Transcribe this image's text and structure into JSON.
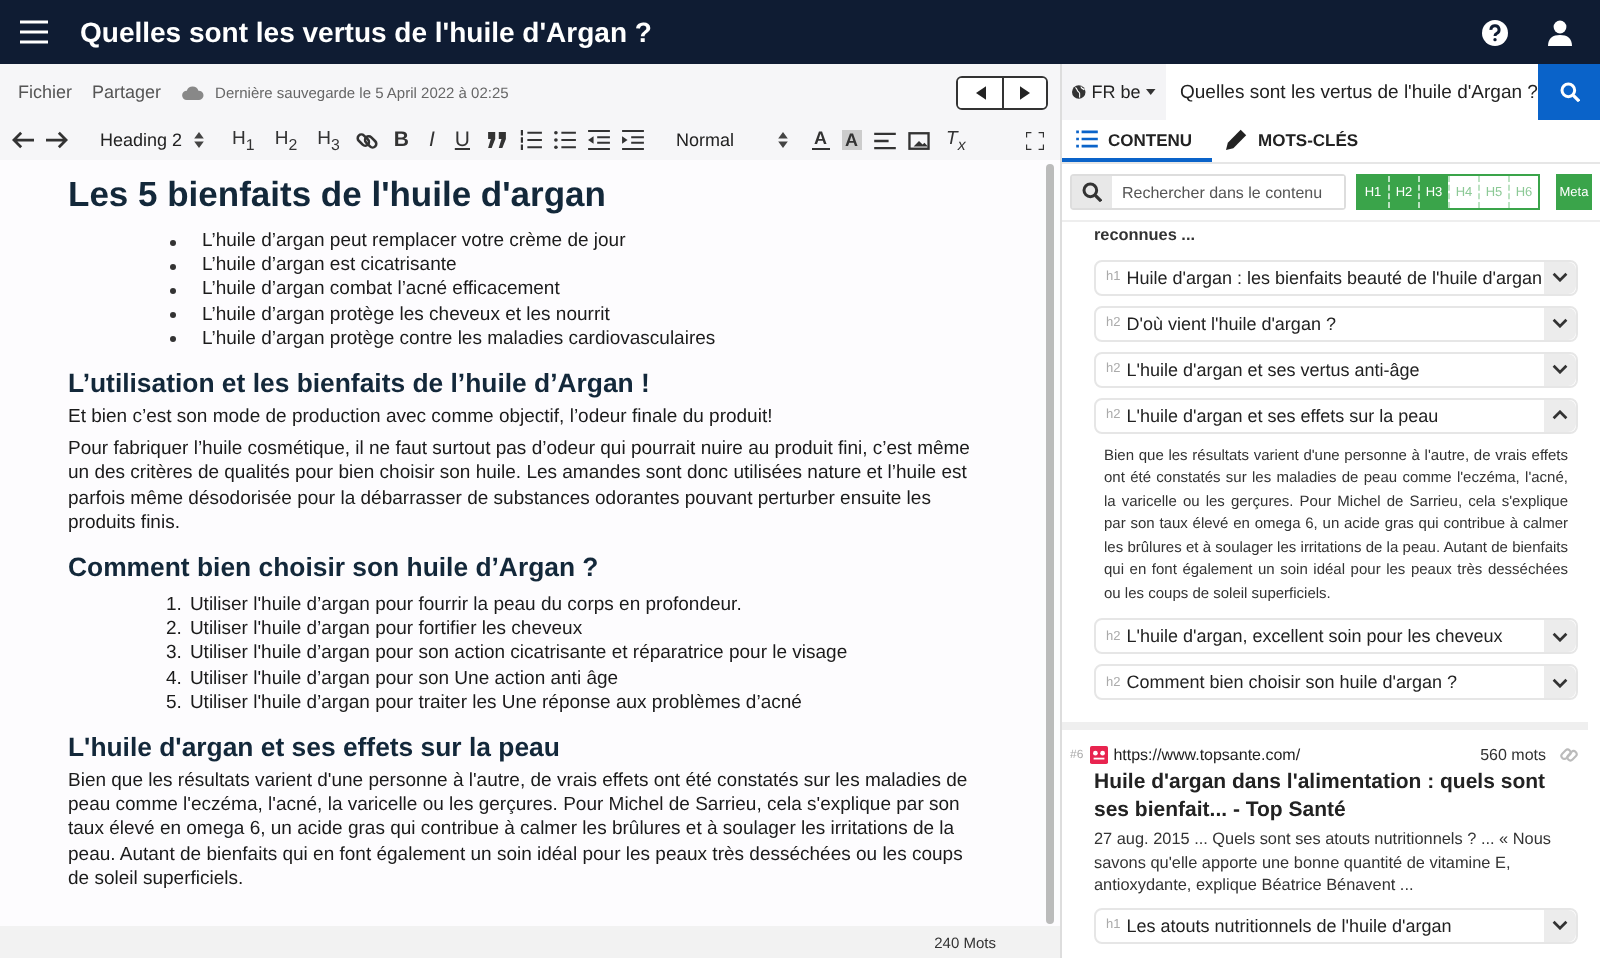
{
  "top_bar": {
    "title": "Quelles sont les vertus de l'huile d'Argan ?"
  },
  "menu": {
    "items": [
      "Fichier",
      "Partager"
    ],
    "save_status": "Dernière sauvegarde le 5 April 2022 à 02:25"
  },
  "toolbar": {
    "heading_select": "Heading 2",
    "heading_buttons": [
      "H$_{1}$",
      "H$_{2}$",
      "H$_{3}$"
    ],
    "format_buttons": [
      "B",
      "I",
      "U"
    ],
    "size_select": "Normal",
    "color_buttons": [
      "A",
      "A"
    ],
    "clear_format": "T$_{x}$"
  },
  "document": [
    {
      "kind": "h1",
      "text": "Les 5 bienfaits de l'huile d'argan"
    },
    {
      "kind": "ul",
      "items": [
        {
          "text": "L’huile d’argan peut remplacer votre crème de jour"
        },
        {
          "text": "L’huile d’argan est cicatrisante"
        },
        {
          "text": "L’huile d’argan combat l’acné efficacement"
        },
        {
          "text": "L’huile d’argan protège les cheveux et les nourrit"
        },
        {
          "text": "L’huile d’argan protège contre les maladies cardiovasculaires"
        }
      ]
    },
    {
      "kind": "h2",
      "text": "L’utilisation et les bienfaits de l’huile d’Argan !"
    },
    {
      "kind": "p",
      "text": "Et bien c’est son mode de production avec comme objectif, l’odeur finale du produit!"
    },
    {
      "kind": "p",
      "text": "Pour fabriquer l’huile cosmétique, il ne faut surtout pas d’odeur qui pourrait nuire au produit fini, c’est même un des critères de qualités pour bien choisir son huile. Les amandes sont donc utilisées nature et l’huile est parfois même désodorisée pour la débarrasser de substances odorantes pouvant perturber ensuite les produits finis."
    },
    {
      "kind": "h2",
      "text": "Comment bien choisir son huile d’Argan ?"
    },
    {
      "kind": "ol",
      "items": [
        {
          "number": "1.",
          "text": "Utiliser l'huile d’argan pour fourrir la peau du corps en profondeur."
        },
        {
          "number": "2.",
          "text": "Utiliser l'huile d’argan pour fortifier les cheveux"
        },
        {
          "number": "3.",
          "text": "Utiliser l'huile d’argan pour son action cicatrisante et réparatrice pour le visage"
        },
        {
          "number": "4.",
          "text": "Utiliser l'huile d’argan pour son Une action anti âge"
        },
        {
          "number": "5.",
          "text": "Utiliser l'huile d’argan pour traiter les Une réponse aux problèmes d’acné"
        }
      ]
    },
    {
      "kind": "h2",
      "text": "L'huile d'argan et ses effets sur la peau"
    },
    {
      "kind": "p",
      "text": "Bien que les résultats varient d'une personne à l'autre, de vrais effets ont été constatés sur les maladies de peau comme l'eczéma, l'acné, la varicelle ou les gerçures. Pour Michel de Sarrieu, cela s'explique par son taux élevé en omega 6, un acide gras qui contribue à calmer les brûlures et à soulager les irritations de la peau. Autant de bienfaits qui en font également un soin idéal pour les peaux très desséchées ou les coups de soleil superficiels."
    }
  ],
  "status_bar": {
    "word_count": "240 Mots"
  },
  "search": {
    "locale": "FR be",
    "query": "Quelles sont les vertus de l'huile d'Argan ?"
  },
  "tabs": [
    {
      "label": "CONTENU",
      "selected": true
    },
    {
      "label": "MOTS-CLÉS",
      "selected": false
    }
  ],
  "filter": {
    "placeholder": "Rechercher dans le contenu",
    "levels": [
      {
        "label": "H1",
        "on": true
      },
      {
        "label": "H2",
        "on": true
      },
      {
        "label": "H3",
        "on": true
      },
      {
        "label": "H4",
        "on": false
      },
      {
        "label": "H5",
        "on": false
      },
      {
        "label": "H6",
        "on": false
      }
    ],
    "meta": {
      "label": "Meta",
      "on": true
    }
  },
  "results": [
    {
      "snippet": "reconnues ...",
      "outline": [
        {
          "level": "h1",
          "text": "Huile d'argan : les bienfaits beauté de l'huile d'argan",
          "expanded": false
        },
        {
          "level": "h2",
          "text": "D'où vient l'huile d'argan ?",
          "expanded": false
        },
        {
          "level": "h2",
          "text": "L'huile d'argan et ses vertus anti-âge",
          "expanded": false
        },
        {
          "level": "h2",
          "text": "L'huile d'argan et ses effets sur la peau",
          "expanded": true,
          "body": "Bien que les résultats varient d'une personne à l'autre, de vrais effets ont été constatés sur les maladies de peau comme l'eczéma, l'acné, la varicelle ou les gerçures. Pour Michel de Sarrieu, cela s'explique par son taux élevé en omega 6, un acide gras qui contribue à calmer les brûlures et à soulager les irritations de la peau. Autant de bienfaits qui en font également un soin idéal pour les peaux très desséchées ou les coups de soleil superficiels."
        },
        {
          "level": "h2",
          "text": "L'huile d'argan, excellent soin pour les cheveux",
          "expanded": false
        },
        {
          "level": "h2",
          "text": "Comment bien choisir son huile d'argan ?",
          "expanded": false
        }
      ]
    },
    {
      "rank": "#6",
      "url": "https://www.topsante.com/",
      "word_count": "560 mots",
      "title": "Huile d'argan dans l'alimentation : quels sont ses bienfait... - Top Santé",
      "snippet": "27 aug. 2015 ... Quels sont ses atouts nutritionnels ? ... « Nous savons qu'elle apporte une bonne quantité de vitamine E, antioxydante, explique Béatrice Bénavent ...",
      "outline": [
        {
          "level": "h1",
          "text": "Les atouts nutritionnels de l'huile d'argan",
          "expanded": false
        }
      ]
    }
  ]
}
